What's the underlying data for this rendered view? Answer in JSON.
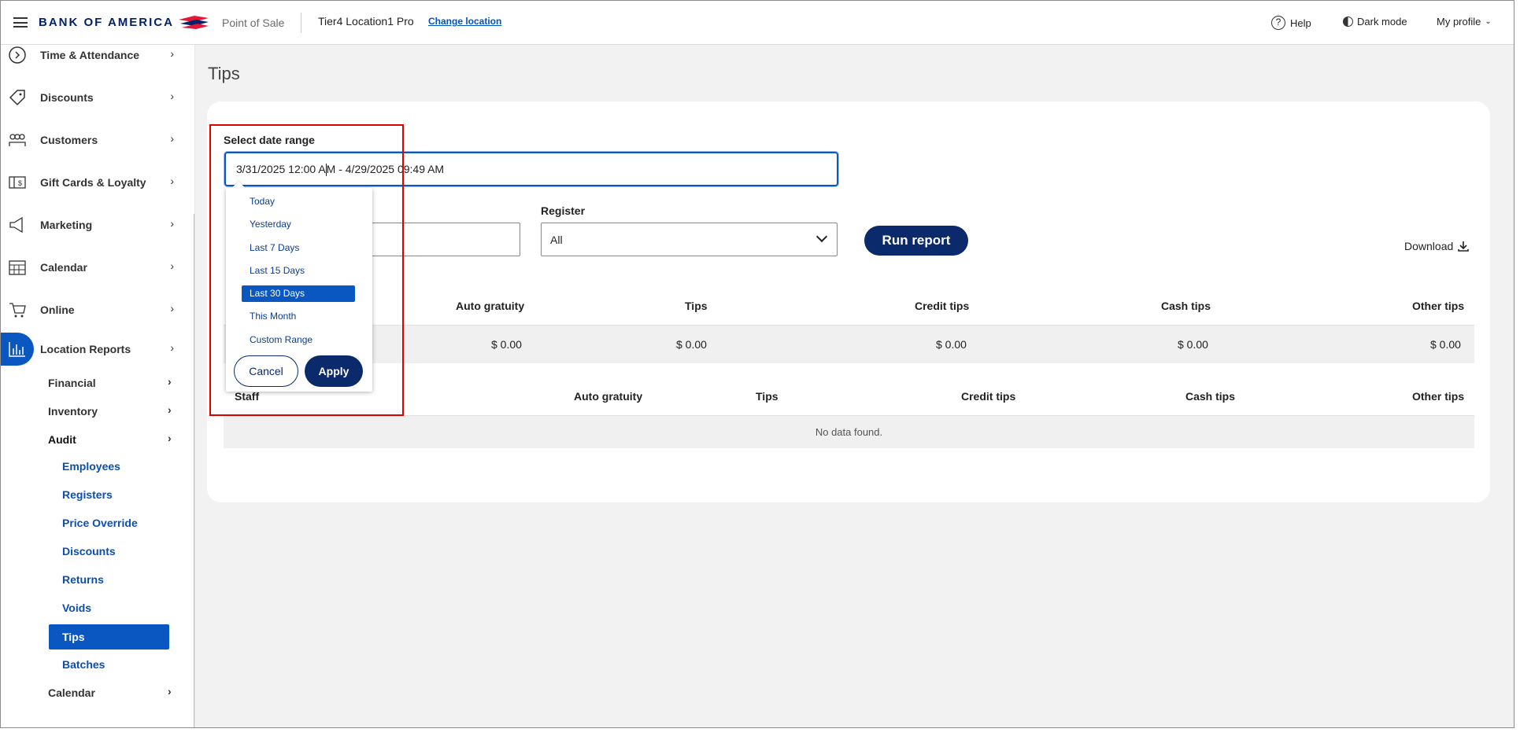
{
  "header": {
    "brand": "BANK OF AMERICA",
    "product": "Point of Sale",
    "location": "Tier4 Location1 Pro",
    "change_location": "Change location",
    "help": "Help",
    "dark_mode": "Dark mode",
    "profile": "My profile",
    "accent": "#012169",
    "flag_red": "#e31837"
  },
  "sidebar": {
    "items": [
      {
        "label": "Time & Attendance",
        "icon": "clock-icon"
      },
      {
        "label": "Discounts",
        "icon": "tag-icon"
      },
      {
        "label": "Customers",
        "icon": "people-icon"
      },
      {
        "label": "Gift Cards & Loyalty",
        "icon": "gift-card-icon"
      },
      {
        "label": "Marketing",
        "icon": "megaphone-icon"
      },
      {
        "label": "Calendar",
        "icon": "calendar-icon"
      },
      {
        "label": "Online",
        "icon": "cart-icon"
      },
      {
        "label": "Location Reports",
        "icon": "bar-chart-icon"
      }
    ],
    "sub_items": {
      "financial": "Financial",
      "inventory": "Inventory",
      "audit": "Audit",
      "calendar": "Calendar"
    },
    "audit_items": {
      "employees": "Employees",
      "registers": "Registers",
      "price_override": "Price Override",
      "discounts": "Discounts",
      "returns": "Returns",
      "voids": "Voids",
      "tips": "Tips",
      "batches": "Batches"
    },
    "active_color": "#0b57c2"
  },
  "main": {
    "title": "Tips",
    "date_range_label": "Select date range",
    "date_range_value_a": "3/31/2025 12:00 A",
    "date_range_value_b": "M - 4/29/2025 09:49 AM",
    "register_label": "Register",
    "register_value": "All",
    "run_report": "Run report",
    "download": "Download"
  },
  "summary_table": {
    "headers": [
      "Auto gratuity",
      "Tips",
      "Credit tips",
      "Cash tips",
      "Other tips"
    ],
    "values": [
      "$ 0.00",
      "$ 0.00",
      "$ 0.00",
      "$ 0.00",
      "$ 0.00"
    ]
  },
  "staff_table": {
    "headers": [
      "Staff",
      "Auto gratuity",
      "Tips",
      "Credit tips",
      "Cash tips",
      "Other tips"
    ],
    "empty": "No data found."
  },
  "dropdown": {
    "options": [
      "Today",
      "Yesterday",
      "Last 7 Days",
      "Last 15 Days",
      "Last 30 Days",
      "This Month",
      "Custom Range"
    ],
    "selected": "Last 30 Days",
    "cancel": "Cancel",
    "apply": "Apply"
  },
  "highlight_color": "#e00000"
}
